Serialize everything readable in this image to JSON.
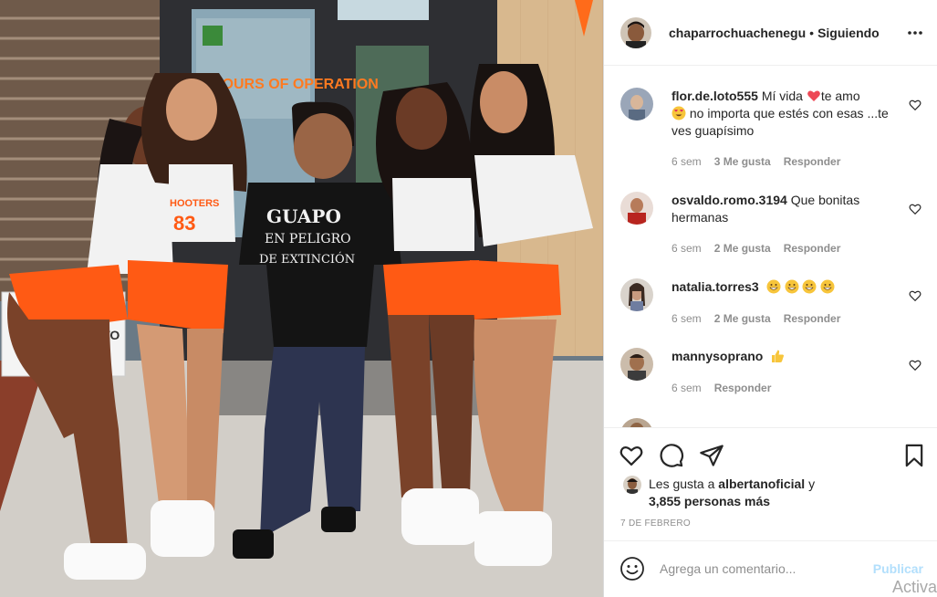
{
  "post": {
    "username": "chaparrochuachenegu",
    "separator": "•",
    "follow_status": "Siguiendo",
    "photo": {
      "door_sign": "HOURS OF OPERATION",
      "shirt_text_1": "GUAPO",
      "shirt_text_2": "EN PELIGRO",
      "shirt_text_3": "DE EXTINCIÓN",
      "jersey_brand": "HOOTERS",
      "jersey_number": "83",
      "sign_text": "ATO"
    }
  },
  "comments": [
    {
      "username": "flor.de.loto555",
      "text_a": "Mí vida",
      "text_b": "te amo",
      "text_c": "no importa que estés con esas ...te ves guapísimo",
      "time": "6 sem",
      "likes": "3 Me gusta",
      "reply": "Responder"
    },
    {
      "username": "osvaldo.romo.3194",
      "text_a": "Que bonitas hermanas",
      "time": "6 sem",
      "likes": "2 Me gusta",
      "reply": "Responder"
    },
    {
      "username": "natalia.torres3",
      "time": "6 sem",
      "likes": "2 Me gusta",
      "reply": "Responder"
    },
    {
      "username": "mannysoprano",
      "time": "6 sem",
      "reply": "Responder"
    }
  ],
  "likes_section": {
    "prefix": "Les gusta a",
    "liker": "albertanoficial",
    "joiner": "y",
    "others": "3,855 personas más",
    "date": "7 DE FEBRERO"
  },
  "add_comment": {
    "placeholder": "Agrega un comentario...",
    "publish": "Publicar"
  },
  "watermark": "Activa",
  "icons": {
    "more": "more-options-icon",
    "like": "heart-icon",
    "comment": "comment-bubble-icon",
    "share": "paper-plane-icon",
    "save": "bookmark-icon",
    "emoji": "smiley-icon"
  },
  "colors": {
    "heart_red": "#ed4956",
    "publish_disabled": "#b2dffc",
    "secondary_text": "#8e8e8e",
    "hooters_orange": "#ff5a14"
  }
}
